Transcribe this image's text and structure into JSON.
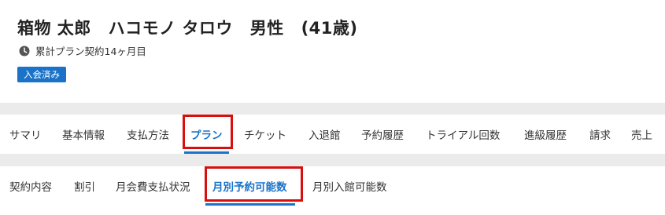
{
  "member": {
    "name_kanji": "箱物 太郎",
    "name_kana": "ハコモノ タロウ",
    "gender": "男性",
    "age": "(41歳)",
    "contract_info": "累計プラン契約14ヶ月目",
    "status_badge": "入会済み"
  },
  "main_tabs": [
    {
      "label": "サマリ"
    },
    {
      "label": "基本情報"
    },
    {
      "label": "支払方法"
    },
    {
      "label": "プラン",
      "active": true
    },
    {
      "label": "チケット"
    },
    {
      "label": "入退館"
    },
    {
      "label": "予約履歴"
    },
    {
      "label": "トライアル回数"
    },
    {
      "label": "進級履歴"
    },
    {
      "label": "請求"
    },
    {
      "label": "売上"
    }
  ],
  "sub_tabs": [
    {
      "label": "契約内容"
    },
    {
      "label": "割引"
    },
    {
      "label": "月会費支払状況"
    },
    {
      "label": "月別予約可能数",
      "active": true
    },
    {
      "label": "月別入館可能数"
    }
  ],
  "colors": {
    "accent": "#1a73c9",
    "highlight_box": "#d80f0f",
    "band": "#ebebeb"
  }
}
